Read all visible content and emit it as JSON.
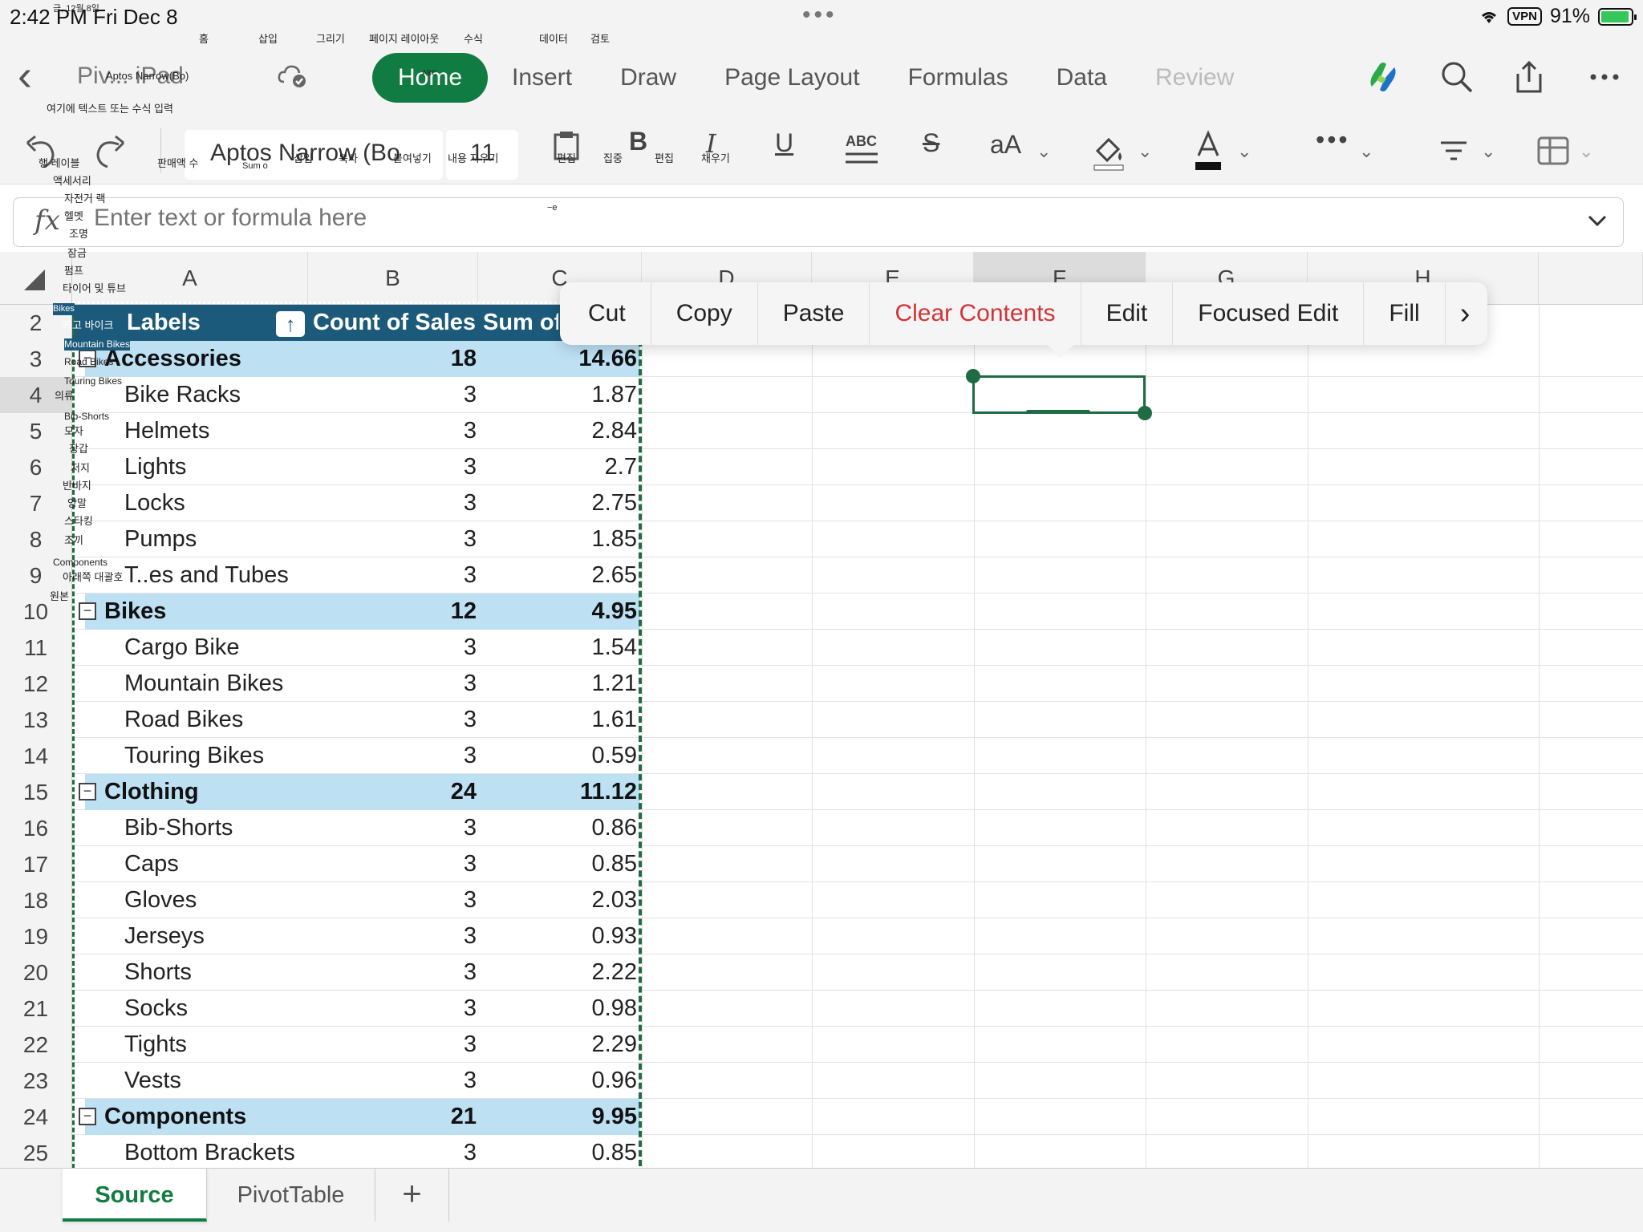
{
  "status_bar": {
    "time": "2:42 PM",
    "date": "Fri Dec 8",
    "vpn": "VPN",
    "battery": "91%"
  },
  "app": {
    "doc_title": "Piv... iPad",
    "tabs": [
      {
        "label": "Home",
        "active": true
      },
      {
        "label": "Insert"
      },
      {
        "label": "Draw"
      },
      {
        "label": "Page Layout"
      },
      {
        "label": "Formulas"
      },
      {
        "label": "Data"
      },
      {
        "label": "Review"
      }
    ]
  },
  "ribbon": {
    "font_name": "Aptos Narrow (Bo",
    "font_size": "11",
    "strike_icon": "strikethrough-icon"
  },
  "formula_bar": {
    "fx": "fx",
    "placeholder": "Enter text or formula here"
  },
  "columns": [
    "A",
    "B",
    "C",
    "D",
    "E",
    "F",
    "G",
    "H"
  ],
  "pivot": {
    "header": {
      "row": "2",
      "labels": "Labels",
      "count": "Count of Sales",
      "sum": "Sum of"
    },
    "rows": [
      {
        "row": "3",
        "type": "group",
        "label": "Accessories",
        "count": "18",
        "sum": "14.66"
      },
      {
        "row": "4",
        "type": "item",
        "label": "Bike Racks",
        "count": "3",
        "sum": "1.87"
      },
      {
        "row": "5",
        "type": "item",
        "label": "Helmets",
        "count": "3",
        "sum": "2.84"
      },
      {
        "row": "6",
        "type": "item",
        "label": "Lights",
        "count": "3",
        "sum": "2.7"
      },
      {
        "row": "7",
        "type": "item",
        "label": "Locks",
        "count": "3",
        "sum": "2.75"
      },
      {
        "row": "8",
        "type": "item",
        "label": "Pumps",
        "count": "3",
        "sum": "1.85"
      },
      {
        "row": "9",
        "type": "item",
        "label": "T..es and Tubes",
        "count": "3",
        "sum": "2.65"
      },
      {
        "row": "10",
        "type": "group",
        "label": "Bikes",
        "count": "12",
        "sum": "4.95"
      },
      {
        "row": "11",
        "type": "item",
        "label": "Cargo Bike",
        "count": "3",
        "sum": "1.54"
      },
      {
        "row": "12",
        "type": "item",
        "label": "Mountain Bikes",
        "count": "3",
        "sum": "1.21"
      },
      {
        "row": "13",
        "type": "item",
        "label": "Road Bikes",
        "count": "3",
        "sum": "1.61"
      },
      {
        "row": "14",
        "type": "item",
        "label": "Touring Bikes",
        "count": "3",
        "sum": "0.59"
      },
      {
        "row": "15",
        "type": "group",
        "label": "Clothing",
        "count": "24",
        "sum": "11.12"
      },
      {
        "row": "16",
        "type": "item",
        "label": "Bib-Shorts",
        "count": "3",
        "sum": "0.86"
      },
      {
        "row": "17",
        "type": "item",
        "label": "Caps",
        "count": "3",
        "sum": "0.85"
      },
      {
        "row": "18",
        "type": "item",
        "label": "Gloves",
        "count": "3",
        "sum": "2.03"
      },
      {
        "row": "19",
        "type": "item",
        "label": "Jerseys",
        "count": "3",
        "sum": "0.93"
      },
      {
        "row": "20",
        "type": "item",
        "label": "Shorts",
        "count": "3",
        "sum": "2.22"
      },
      {
        "row": "21",
        "type": "item",
        "label": "Socks",
        "count": "3",
        "sum": "0.98"
      },
      {
        "row": "22",
        "type": "item",
        "label": "Tights",
        "count": "3",
        "sum": "2.29"
      },
      {
        "row": "23",
        "type": "item",
        "label": "Vests",
        "count": "3",
        "sum": "0.96"
      },
      {
        "row": "24",
        "type": "group",
        "label": "Components",
        "count": "21",
        "sum": "9.95"
      },
      {
        "row": "25",
        "type": "item",
        "label": "Bottom Brackets",
        "count": "3",
        "sum": "0.85"
      }
    ]
  },
  "context_menu": {
    "items": [
      {
        "label": "Cut"
      },
      {
        "label": "Copy"
      },
      {
        "label": "Paste"
      },
      {
        "label": "Clear Contents",
        "danger": true
      },
      {
        "label": "Edit"
      },
      {
        "label": "Focused Edit"
      },
      {
        "label": "Fill"
      }
    ],
    "more": "›"
  },
  "sheets": [
    {
      "label": "Source",
      "active": true
    },
    {
      "label": "PivotTable"
    }
  ],
  "add_sheet": "+",
  "overlay": {
    "tab_labels": [
      "홈",
      "삽입",
      "그리기",
      "페이지 레이아웃",
      "수식",
      "데이터",
      "검토"
    ],
    "date_small": "금, 12월 8일",
    "font_small": "Aptos Narrow(Bo)",
    "abc_small": "ABC",
    "formula_hint": "여기에 텍스트 또는 수식 입력",
    "ribbon_labels": [
      "판매액 수",
      "Sum o",
      "삽입",
      "복사",
      "붙여넣기",
      "내용 지우기",
      "편집",
      "집중",
      "편집",
      "채우기"
    ],
    "tiny_mark": "−e",
    "row_labels": [
      "행 레이블",
      "액세서리",
      "자전거 랙",
      "헬멧",
      "조명",
      "잠금",
      "펌프",
      "타이어 및 튜브"
    ],
    "bikes_tag": "Bikes",
    "bike_labels": [
      "카고 바이크",
      "Mountain Bikes",
      "Road Bikes",
      "Touring Bikes"
    ],
    "clothing_labels": [
      "의류",
      "Bib-Shorts",
      "모자",
      "장갑",
      "저지",
      "반바지",
      "양말",
      "스타킹",
      "조끼"
    ],
    "comp_labels": [
      "Components",
      "아래쪽 대괄호"
    ],
    "source_small": "원본"
  }
}
